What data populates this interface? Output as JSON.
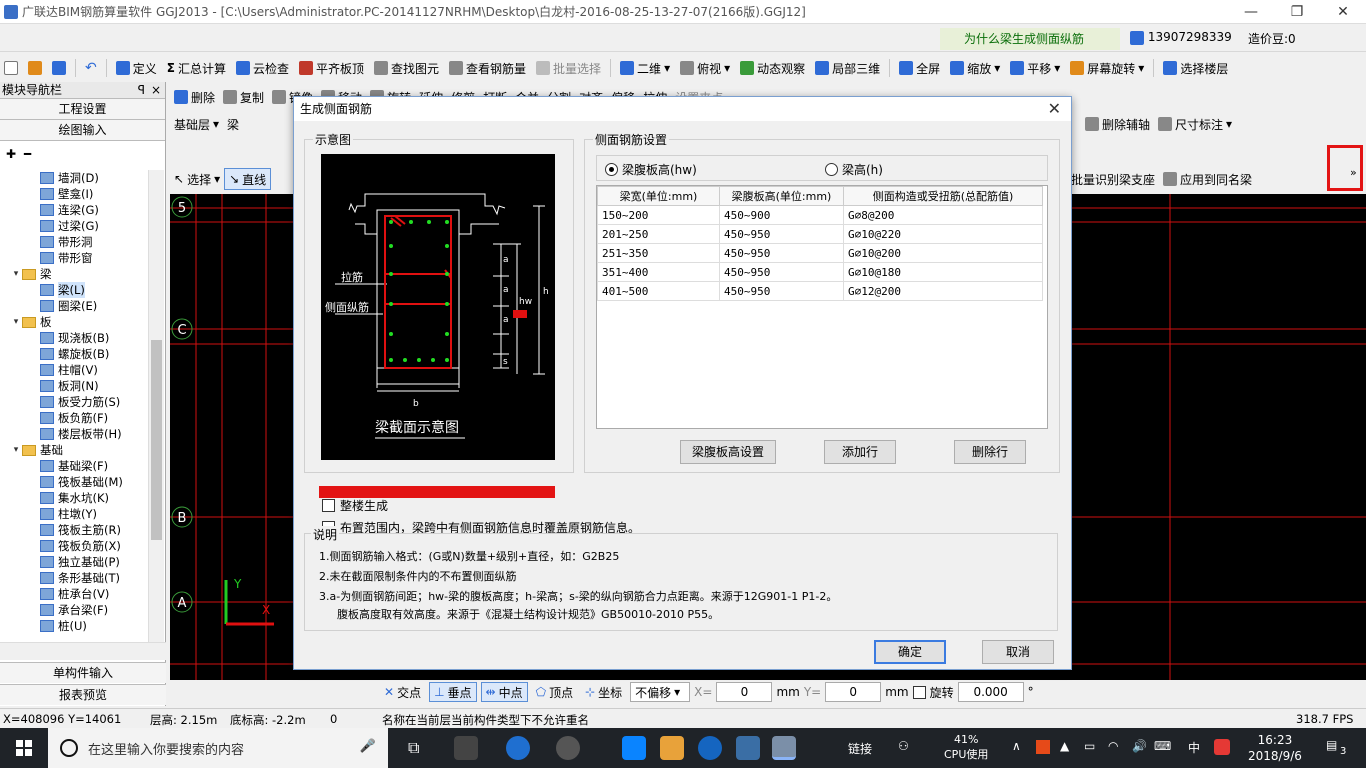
{
  "window": {
    "title": "广联达BIM钢筋算量软件 GGJ2013 - [C:\\Users\\Administrator.PC-20141127NRHM\\Desktop\\白龙村-2016-08-25-13-27-07(2166版).GGJ12]",
    "minimize": "—",
    "restore": "❐",
    "close": "✕"
  },
  "infobar": {
    "question": "为什么梁生成侧面纵筋",
    "account": "13907298339",
    "cost": "造价豆:0"
  },
  "toolbar1": {
    "define": "定义",
    "summary": "汇总计算",
    "cloud_check": "云检查",
    "flat_slab": "平齐板顶",
    "find_element": "查找图元",
    "view_rebar": "查看钢筋量",
    "batch_select": "批量选择",
    "view_2d": "二维",
    "top_view": "俯视",
    "dynamic_view": "动态观察",
    "local_3d": "局部三维",
    "fullscreen": "全屏",
    "zoom": "缩放",
    "pan": "平移",
    "screen_rotate": "屏幕旋转",
    "select_floor": "选择楼层"
  },
  "sidebar": {
    "header": "模块导航栏",
    "pin": "ꟼ",
    "close": "×",
    "project_settings": "工程设置",
    "drawing_input": "绘图输入",
    "single_input": "单构件输入",
    "report_preview": "报表预览",
    "tree": [
      {
        "label": "墙洞(D)",
        "type": "item"
      },
      {
        "label": "壁龛(I)",
        "type": "item"
      },
      {
        "label": "连梁(G)",
        "type": "item"
      },
      {
        "label": "过梁(G)",
        "type": "item"
      },
      {
        "label": "带形洞",
        "type": "item"
      },
      {
        "label": "带形窗",
        "type": "item"
      },
      {
        "label": "梁",
        "type": "folder"
      },
      {
        "label": "梁(L)",
        "type": "item",
        "selected": true
      },
      {
        "label": "圈梁(E)",
        "type": "item"
      },
      {
        "label": "板",
        "type": "folder"
      },
      {
        "label": "现浇板(B)",
        "type": "item"
      },
      {
        "label": "螺旋板(B)",
        "type": "item"
      },
      {
        "label": "柱帽(V)",
        "type": "item"
      },
      {
        "label": "板洞(N)",
        "type": "item"
      },
      {
        "label": "板受力筋(S)",
        "type": "item"
      },
      {
        "label": "板负筋(F)",
        "type": "item"
      },
      {
        "label": "楼层板带(H)",
        "type": "item"
      },
      {
        "label": "基础",
        "type": "folder"
      },
      {
        "label": "基础梁(F)",
        "type": "item"
      },
      {
        "label": "筏板基础(M)",
        "type": "item"
      },
      {
        "label": "集水坑(K)",
        "type": "item"
      },
      {
        "label": "柱墩(Y)",
        "type": "item"
      },
      {
        "label": "筏板主筋(R)",
        "type": "item"
      },
      {
        "label": "筏板负筋(X)",
        "type": "item"
      },
      {
        "label": "独立基础(P)",
        "type": "item"
      },
      {
        "label": "条形基础(T)",
        "type": "item"
      },
      {
        "label": "桩承台(V)",
        "type": "item"
      },
      {
        "label": "承台梁(F)",
        "type": "item"
      },
      {
        "label": "桩(U)",
        "type": "item"
      }
    ]
  },
  "toolbar2": {
    "delete": "删除",
    "copy": "复制",
    "mirror": "镜像",
    "move": "移动",
    "rotate": "旋转",
    "extend": "延伸",
    "trim": "修剪",
    "break": "打断",
    "merge": "合并",
    "split": "分割",
    "align": "对齐",
    "offset": "偏移",
    "stretch": "拉伸",
    "set_point": "设置夹点"
  },
  "toolbar3": {
    "floor": "基础层",
    "type": "梁",
    "delete_aux": "删除辅轴",
    "dimension": "尺寸标注"
  },
  "toolbar4": {
    "select": "选择",
    "line": "直线",
    "batch_support": "批量识别梁支座",
    "apply_same": "应用到同名梁"
  },
  "canvas": {
    "axis_labels": [
      "5",
      "C",
      "B",
      "A"
    ],
    "y_axis": "Y",
    "x_axis": "X",
    "expand": "»"
  },
  "snapbar": {
    "intersection": "交点",
    "perpendicular": "垂点",
    "midpoint": "中点",
    "vertex": "顶点",
    "coordinate": "坐标",
    "offset_mode": "不偏移",
    "x_label": "X=",
    "x_value": "0",
    "y_label": "Y=",
    "y_value": "0",
    "unit": "mm",
    "rotate_label": "旋转",
    "rotate_value": "0.000",
    "degree": "°"
  },
  "status": {
    "coords": "X=408096 Y=14061",
    "floor_height": "层高: 2.15m",
    "bottom_height": "底标高: -2.2m",
    "count": "0",
    "message": "名称在当前层当前构件类型下不允许重名",
    "fps": "318.7 FPS"
  },
  "taskbar": {
    "search_placeholder": "在这里输入你要搜索的内容",
    "link": "链接",
    "cpu_percent": "41%",
    "cpu_label": "CPU使用",
    "ime": "中",
    "time": "16:23",
    "date": "2018/9/6",
    "notify_count": "3"
  },
  "dialog": {
    "title": "生成侧面钢筋",
    "close": "✕",
    "diagram_group": "示意图",
    "settings_group": "侧面钢筋设置",
    "radio_hw": "梁腹板高(hw)",
    "radio_h": "梁高(h)",
    "columns": [
      "梁宽(单位:mm)",
      "梁腹板高(单位:mm)",
      "侧面构造或受扭筋(总配筋值)"
    ],
    "rows": [
      [
        "150~200",
        "450~900",
        "G⌀8@200"
      ],
      [
        "201~250",
        "450~950",
        "G⌀10@220"
      ],
      [
        "251~350",
        "450~950",
        "G⌀10@200"
      ],
      [
        "351~400",
        "450~950",
        "G⌀10@180"
      ],
      [
        "401~500",
        "450~950",
        "G⌀12@200"
      ]
    ],
    "btn_web_height": "梁腹板高设置",
    "btn_add_row": "添加行",
    "btn_delete_row": "删除行",
    "chk_whole_building": "整楼生成",
    "chk_override": "布置范围内，梁跨中有侧面钢筋信息时覆盖原钢筋信息。",
    "notes_label": "说明",
    "notes": [
      "1.侧面钢筋输入格式：(G或N)数量+级别+直径，如：G2B25",
      "2.未在截面限制条件内的不布置侧面纵筋",
      "3.a-为侧面钢筋间距；hw-梁的腹板高度；h-梁高；s-梁的纵向钢筋合力点距离。来源于12G901-1 P1-2。",
      "腹板高度取有效高度。来源于《混凝土结构设计规范》GB50010-2010 P55。"
    ],
    "ok": "确定",
    "cancel": "取消",
    "diagram": {
      "tie_label": "拉筋",
      "side_label": "侧面纵筋",
      "a": "a",
      "hw": "hw",
      "h": "h",
      "s": "s",
      "b": "b",
      "caption": "梁截面示意图"
    }
  }
}
